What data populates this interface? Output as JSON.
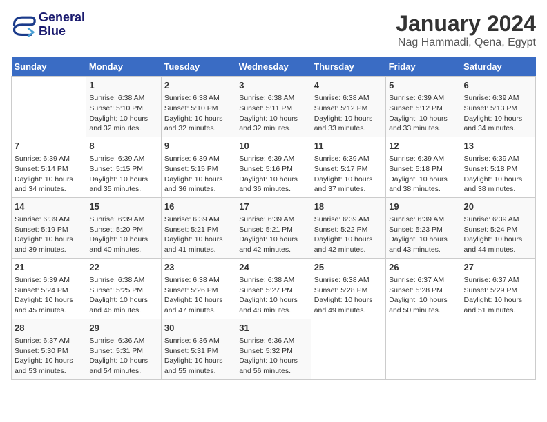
{
  "logo": {
    "line1": "General",
    "line2": "Blue"
  },
  "title": "January 2024",
  "subtitle": "Nag Hammadi, Qena, Egypt",
  "weekdays": [
    "Sunday",
    "Monday",
    "Tuesday",
    "Wednesday",
    "Thursday",
    "Friday",
    "Saturday"
  ],
  "weeks": [
    [
      {
        "day": null
      },
      {
        "day": 1,
        "sunrise": "6:38 AM",
        "sunset": "5:10 PM",
        "daylight": "10 hours and 32 minutes."
      },
      {
        "day": 2,
        "sunrise": "6:38 AM",
        "sunset": "5:10 PM",
        "daylight": "10 hours and 32 minutes."
      },
      {
        "day": 3,
        "sunrise": "6:38 AM",
        "sunset": "5:11 PM",
        "daylight": "10 hours and 32 minutes."
      },
      {
        "day": 4,
        "sunrise": "6:38 AM",
        "sunset": "5:12 PM",
        "daylight": "10 hours and 33 minutes."
      },
      {
        "day": 5,
        "sunrise": "6:39 AM",
        "sunset": "5:12 PM",
        "daylight": "10 hours and 33 minutes."
      },
      {
        "day": 6,
        "sunrise": "6:39 AM",
        "sunset": "5:13 PM",
        "daylight": "10 hours and 34 minutes."
      }
    ],
    [
      {
        "day": 7,
        "sunrise": "6:39 AM",
        "sunset": "5:14 PM",
        "daylight": "10 hours and 34 minutes."
      },
      {
        "day": 8,
        "sunrise": "6:39 AM",
        "sunset": "5:15 PM",
        "daylight": "10 hours and 35 minutes."
      },
      {
        "day": 9,
        "sunrise": "6:39 AM",
        "sunset": "5:15 PM",
        "daylight": "10 hours and 36 minutes."
      },
      {
        "day": 10,
        "sunrise": "6:39 AM",
        "sunset": "5:16 PM",
        "daylight": "10 hours and 36 minutes."
      },
      {
        "day": 11,
        "sunrise": "6:39 AM",
        "sunset": "5:17 PM",
        "daylight": "10 hours and 37 minutes."
      },
      {
        "day": 12,
        "sunrise": "6:39 AM",
        "sunset": "5:18 PM",
        "daylight": "10 hours and 38 minutes."
      },
      {
        "day": 13,
        "sunrise": "6:39 AM",
        "sunset": "5:18 PM",
        "daylight": "10 hours and 38 minutes."
      }
    ],
    [
      {
        "day": 14,
        "sunrise": "6:39 AM",
        "sunset": "5:19 PM",
        "daylight": "10 hours and 39 minutes."
      },
      {
        "day": 15,
        "sunrise": "6:39 AM",
        "sunset": "5:20 PM",
        "daylight": "10 hours and 40 minutes."
      },
      {
        "day": 16,
        "sunrise": "6:39 AM",
        "sunset": "5:21 PM",
        "daylight": "10 hours and 41 minutes."
      },
      {
        "day": 17,
        "sunrise": "6:39 AM",
        "sunset": "5:21 PM",
        "daylight": "10 hours and 42 minutes."
      },
      {
        "day": 18,
        "sunrise": "6:39 AM",
        "sunset": "5:22 PM",
        "daylight": "10 hours and 42 minutes."
      },
      {
        "day": 19,
        "sunrise": "6:39 AM",
        "sunset": "5:23 PM",
        "daylight": "10 hours and 43 minutes."
      },
      {
        "day": 20,
        "sunrise": "6:39 AM",
        "sunset": "5:24 PM",
        "daylight": "10 hours and 44 minutes."
      }
    ],
    [
      {
        "day": 21,
        "sunrise": "6:39 AM",
        "sunset": "5:24 PM",
        "daylight": "10 hours and 45 minutes."
      },
      {
        "day": 22,
        "sunrise": "6:38 AM",
        "sunset": "5:25 PM",
        "daylight": "10 hours and 46 minutes."
      },
      {
        "day": 23,
        "sunrise": "6:38 AM",
        "sunset": "5:26 PM",
        "daylight": "10 hours and 47 minutes."
      },
      {
        "day": 24,
        "sunrise": "6:38 AM",
        "sunset": "5:27 PM",
        "daylight": "10 hours and 48 minutes."
      },
      {
        "day": 25,
        "sunrise": "6:38 AM",
        "sunset": "5:28 PM",
        "daylight": "10 hours and 49 minutes."
      },
      {
        "day": 26,
        "sunrise": "6:37 AM",
        "sunset": "5:28 PM",
        "daylight": "10 hours and 50 minutes."
      },
      {
        "day": 27,
        "sunrise": "6:37 AM",
        "sunset": "5:29 PM",
        "daylight": "10 hours and 51 minutes."
      }
    ],
    [
      {
        "day": 28,
        "sunrise": "6:37 AM",
        "sunset": "5:30 PM",
        "daylight": "10 hours and 53 minutes."
      },
      {
        "day": 29,
        "sunrise": "6:36 AM",
        "sunset": "5:31 PM",
        "daylight": "10 hours and 54 minutes."
      },
      {
        "day": 30,
        "sunrise": "6:36 AM",
        "sunset": "5:31 PM",
        "daylight": "10 hours and 55 minutes."
      },
      {
        "day": 31,
        "sunrise": "6:36 AM",
        "sunset": "5:32 PM",
        "daylight": "10 hours and 56 minutes."
      },
      {
        "day": null
      },
      {
        "day": null
      },
      {
        "day": null
      }
    ]
  ],
  "labels": {
    "sunrise": "Sunrise:",
    "sunset": "Sunset:",
    "daylight": "Daylight:"
  }
}
